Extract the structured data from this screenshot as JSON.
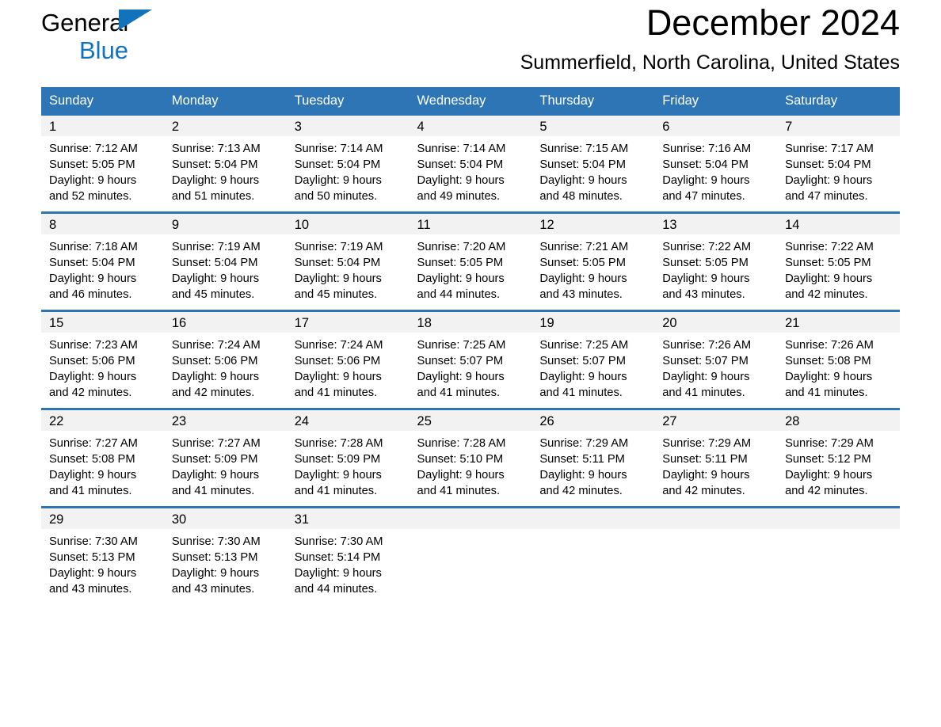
{
  "brand": {
    "line1": "General",
    "line2": "Blue",
    "accent_color": "#1273bd"
  },
  "header": {
    "month_title": "December 2024",
    "location": "Summerfield, North Carolina, United States"
  },
  "colors": {
    "header_blue": "#2e75b6",
    "day_band_gray": "#f2f2f2",
    "text": "#000000",
    "header_text": "#ffffff"
  },
  "calendar": {
    "weekday_headers": [
      "Sunday",
      "Monday",
      "Tuesday",
      "Wednesday",
      "Thursday",
      "Friday",
      "Saturday"
    ],
    "weeks": [
      [
        {
          "day": "1",
          "sunrise": "Sunrise: 7:12 AM",
          "sunset": "Sunset: 5:05 PM",
          "daylight_1": "Daylight: 9 hours",
          "daylight_2": "and 52 minutes."
        },
        {
          "day": "2",
          "sunrise": "Sunrise: 7:13 AM",
          "sunset": "Sunset: 5:04 PM",
          "daylight_1": "Daylight: 9 hours",
          "daylight_2": "and 51 minutes."
        },
        {
          "day": "3",
          "sunrise": "Sunrise: 7:14 AM",
          "sunset": "Sunset: 5:04 PM",
          "daylight_1": "Daylight: 9 hours",
          "daylight_2": "and 50 minutes."
        },
        {
          "day": "4",
          "sunrise": "Sunrise: 7:14 AM",
          "sunset": "Sunset: 5:04 PM",
          "daylight_1": "Daylight: 9 hours",
          "daylight_2": "and 49 minutes."
        },
        {
          "day": "5",
          "sunrise": "Sunrise: 7:15 AM",
          "sunset": "Sunset: 5:04 PM",
          "daylight_1": "Daylight: 9 hours",
          "daylight_2": "and 48 minutes."
        },
        {
          "day": "6",
          "sunrise": "Sunrise: 7:16 AM",
          "sunset": "Sunset: 5:04 PM",
          "daylight_1": "Daylight: 9 hours",
          "daylight_2": "and 47 minutes."
        },
        {
          "day": "7",
          "sunrise": "Sunrise: 7:17 AM",
          "sunset": "Sunset: 5:04 PM",
          "daylight_1": "Daylight: 9 hours",
          "daylight_2": "and 47 minutes."
        }
      ],
      [
        {
          "day": "8",
          "sunrise": "Sunrise: 7:18 AM",
          "sunset": "Sunset: 5:04 PM",
          "daylight_1": "Daylight: 9 hours",
          "daylight_2": "and 46 minutes."
        },
        {
          "day": "9",
          "sunrise": "Sunrise: 7:19 AM",
          "sunset": "Sunset: 5:04 PM",
          "daylight_1": "Daylight: 9 hours",
          "daylight_2": "and 45 minutes."
        },
        {
          "day": "10",
          "sunrise": "Sunrise: 7:19 AM",
          "sunset": "Sunset: 5:04 PM",
          "daylight_1": "Daylight: 9 hours",
          "daylight_2": "and 45 minutes."
        },
        {
          "day": "11",
          "sunrise": "Sunrise: 7:20 AM",
          "sunset": "Sunset: 5:05 PM",
          "daylight_1": "Daylight: 9 hours",
          "daylight_2": "and 44 minutes."
        },
        {
          "day": "12",
          "sunrise": "Sunrise: 7:21 AM",
          "sunset": "Sunset: 5:05 PM",
          "daylight_1": "Daylight: 9 hours",
          "daylight_2": "and 43 minutes."
        },
        {
          "day": "13",
          "sunrise": "Sunrise: 7:22 AM",
          "sunset": "Sunset: 5:05 PM",
          "daylight_1": "Daylight: 9 hours",
          "daylight_2": "and 43 minutes."
        },
        {
          "day": "14",
          "sunrise": "Sunrise: 7:22 AM",
          "sunset": "Sunset: 5:05 PM",
          "daylight_1": "Daylight: 9 hours",
          "daylight_2": "and 42 minutes."
        }
      ],
      [
        {
          "day": "15",
          "sunrise": "Sunrise: 7:23 AM",
          "sunset": "Sunset: 5:06 PM",
          "daylight_1": "Daylight: 9 hours",
          "daylight_2": "and 42 minutes."
        },
        {
          "day": "16",
          "sunrise": "Sunrise: 7:24 AM",
          "sunset": "Sunset: 5:06 PM",
          "daylight_1": "Daylight: 9 hours",
          "daylight_2": "and 42 minutes."
        },
        {
          "day": "17",
          "sunrise": "Sunrise: 7:24 AM",
          "sunset": "Sunset: 5:06 PM",
          "daylight_1": "Daylight: 9 hours",
          "daylight_2": "and 41 minutes."
        },
        {
          "day": "18",
          "sunrise": "Sunrise: 7:25 AM",
          "sunset": "Sunset: 5:07 PM",
          "daylight_1": "Daylight: 9 hours",
          "daylight_2": "and 41 minutes."
        },
        {
          "day": "19",
          "sunrise": "Sunrise: 7:25 AM",
          "sunset": "Sunset: 5:07 PM",
          "daylight_1": "Daylight: 9 hours",
          "daylight_2": "and 41 minutes."
        },
        {
          "day": "20",
          "sunrise": "Sunrise: 7:26 AM",
          "sunset": "Sunset: 5:07 PM",
          "daylight_1": "Daylight: 9 hours",
          "daylight_2": "and 41 minutes."
        },
        {
          "day": "21",
          "sunrise": "Sunrise: 7:26 AM",
          "sunset": "Sunset: 5:08 PM",
          "daylight_1": "Daylight: 9 hours",
          "daylight_2": "and 41 minutes."
        }
      ],
      [
        {
          "day": "22",
          "sunrise": "Sunrise: 7:27 AM",
          "sunset": "Sunset: 5:08 PM",
          "daylight_1": "Daylight: 9 hours",
          "daylight_2": "and 41 minutes."
        },
        {
          "day": "23",
          "sunrise": "Sunrise: 7:27 AM",
          "sunset": "Sunset: 5:09 PM",
          "daylight_1": "Daylight: 9 hours",
          "daylight_2": "and 41 minutes."
        },
        {
          "day": "24",
          "sunrise": "Sunrise: 7:28 AM",
          "sunset": "Sunset: 5:09 PM",
          "daylight_1": "Daylight: 9 hours",
          "daylight_2": "and 41 minutes."
        },
        {
          "day": "25",
          "sunrise": "Sunrise: 7:28 AM",
          "sunset": "Sunset: 5:10 PM",
          "daylight_1": "Daylight: 9 hours",
          "daylight_2": "and 41 minutes."
        },
        {
          "day": "26",
          "sunrise": "Sunrise: 7:29 AM",
          "sunset": "Sunset: 5:11 PM",
          "daylight_1": "Daylight: 9 hours",
          "daylight_2": "and 42 minutes."
        },
        {
          "day": "27",
          "sunrise": "Sunrise: 7:29 AM",
          "sunset": "Sunset: 5:11 PM",
          "daylight_1": "Daylight: 9 hours",
          "daylight_2": "and 42 minutes."
        },
        {
          "day": "28",
          "sunrise": "Sunrise: 7:29 AM",
          "sunset": "Sunset: 5:12 PM",
          "daylight_1": "Daylight: 9 hours",
          "daylight_2": "and 42 minutes."
        }
      ],
      [
        {
          "day": "29",
          "sunrise": "Sunrise: 7:30 AM",
          "sunset": "Sunset: 5:13 PM",
          "daylight_1": "Daylight: 9 hours",
          "daylight_2": "and 43 minutes."
        },
        {
          "day": "30",
          "sunrise": "Sunrise: 7:30 AM",
          "sunset": "Sunset: 5:13 PM",
          "daylight_1": "Daylight: 9 hours",
          "daylight_2": "and 43 minutes."
        },
        {
          "day": "31",
          "sunrise": "Sunrise: 7:30 AM",
          "sunset": "Sunset: 5:14 PM",
          "daylight_1": "Daylight: 9 hours",
          "daylight_2": "and 44 minutes."
        },
        {
          "day": "",
          "sunrise": "",
          "sunset": "",
          "daylight_1": "",
          "daylight_2": "",
          "empty": true
        },
        {
          "day": "",
          "sunrise": "",
          "sunset": "",
          "daylight_1": "",
          "daylight_2": "",
          "empty": true
        },
        {
          "day": "",
          "sunrise": "",
          "sunset": "",
          "daylight_1": "",
          "daylight_2": "",
          "empty": true
        },
        {
          "day": "",
          "sunrise": "",
          "sunset": "",
          "daylight_1": "",
          "daylight_2": "",
          "empty": true
        }
      ]
    ]
  }
}
